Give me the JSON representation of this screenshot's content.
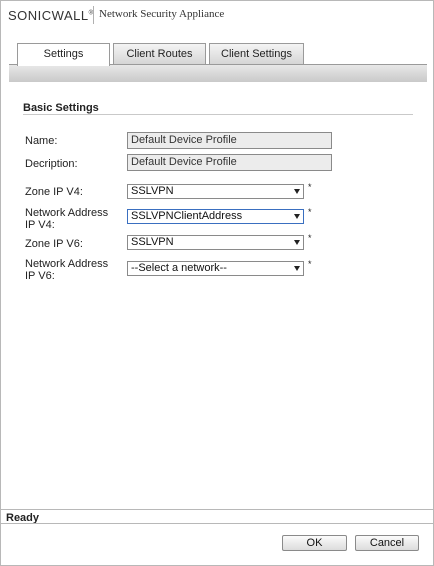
{
  "header": {
    "logo_text": "SONICWALL",
    "app_title": "Network Security Appliance"
  },
  "tabs": [
    {
      "label": "Settings",
      "active": true
    },
    {
      "label": "Client Routes",
      "active": false
    },
    {
      "label": "Client Settings",
      "active": false
    }
  ],
  "section": {
    "title": "Basic Settings"
  },
  "form": {
    "name_label": "Name:",
    "name_value": "Default Device Profile",
    "description_label": "Decription:",
    "description_value": "Default Device Profile",
    "zone_v4_label": "Zone IP V4:",
    "zone_v4_value": "SSLVPN",
    "network_v4_label": "Network Address IP V4:",
    "network_v4_value": "SSLVPNClientAddress",
    "zone_v6_label": "Zone IP V6:",
    "zone_v6_value": "SSLVPN",
    "network_v6_label": "Network Address IP V6:",
    "network_v6_value": "--Select a network--",
    "required_marker": "*"
  },
  "status": {
    "text": "Ready"
  },
  "buttons": {
    "ok_label": "OK",
    "cancel_label": "Cancel"
  },
  "icons": {
    "dropdown": "chevron-down-icon"
  }
}
